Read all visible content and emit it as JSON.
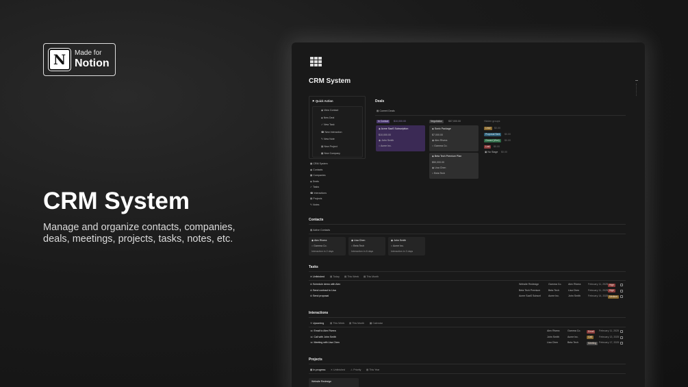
{
  "badge": {
    "made_for": "Made for",
    "notion": "Notion",
    "logo_letter": "N"
  },
  "hero": {
    "title": "CRM System",
    "subtitle": "Manage and organize contacts, companies, deals, meetings, projects, tasks, notes, etc."
  },
  "page": {
    "title": "CRM System",
    "icon": "grid-icon"
  },
  "quick_action": {
    "title": "Quick Action",
    "items": [
      "View Contact",
      "New Deal",
      "New Task",
      "New Interaction",
      "New Note",
      "New Project",
      "New Company"
    ]
  },
  "nav": {
    "items": [
      "CRM System",
      "Contacts",
      "Companies",
      "Deals",
      "Tasks",
      "Interactions",
      "Projects",
      "Notes"
    ]
  },
  "deals": {
    "title": "Deals",
    "view": "Current Deals",
    "col1": {
      "status": "In Contact",
      "amount": "$10,000.00",
      "card": {
        "title": "Acme SaaS Subscription",
        "amount": "$10,000.00",
        "contact": "John Smith",
        "company": "Acme Inc."
      }
    },
    "col2": {
      "status": "Negotiation",
      "amount": "$57,000.00",
      "cards": [
        {
          "title": "Sonic Package",
          "amount": "$7,000.00",
          "contact": "Alex Rivera",
          "company": "Gamma Co."
        },
        {
          "title": "Beta Tech Premium Plan",
          "amount": "$50,000.00",
          "contact": "Lisa Chen",
          "company": "Beta Tech"
        }
      ]
    },
    "hidden": {
      "title": "Hidden groups",
      "groups": [
        {
          "label": "Lead",
          "amount": "$0.00",
          "color": "#c7893f"
        },
        {
          "label": "Proposal Sent",
          "amount": "$0.00",
          "color": "#2e6f8f"
        },
        {
          "label": "Closed (Won)",
          "amount": "$0.00",
          "color": "#2f7a4f"
        },
        {
          "label": "Lost",
          "amount": "$0.00",
          "color": "#a23b3b"
        }
      ],
      "no_stage": "No Stage",
      "no_stage_amount": "$0.00"
    }
  },
  "contacts": {
    "title": "Contacts",
    "view": "Active Contacts",
    "cards": [
      {
        "name": "Alex Rivera",
        "company": "Gamma Co.",
        "note": "Interaction in 2 days"
      },
      {
        "name": "Lisa Chen",
        "company": "Beta Tech",
        "note": "Interaction in 8 days"
      },
      {
        "name": "John Smith",
        "company": "Acme Inc.",
        "note": "Interaction in 3 days"
      }
    ]
  },
  "tasks": {
    "title": "Tasks",
    "tabs": [
      "Unfinished",
      "Today",
      "This Week",
      "This Month"
    ],
    "rows": [
      {
        "title": "Schedule demo with Alex",
        "project": "Website Redesign",
        "company": "Gamma Co.",
        "contact": "Alex Rivera",
        "date": "February 11, 2025",
        "priority": "High",
        "pcolor": "#8a3a3a"
      },
      {
        "title": "Send contract to Lisa",
        "project": "Beta Tech Premium",
        "company": "Beta Tech",
        "contact": "Lisa Chen",
        "date": "February 11, 2025",
        "priority": "High",
        "pcolor": "#8a3a3a"
      },
      {
        "title": "Send proposal",
        "project": "Acme SaaS Subscri",
        "company": "Acme Inc.",
        "contact": "John Smith",
        "date": "February 14, 2025",
        "priority": "Medium",
        "pcolor": "#8a6a2f"
      }
    ]
  },
  "interactions": {
    "title": "Interactions",
    "tabs": [
      "Upcoming",
      "This Week",
      "This Month",
      "Calendar"
    ],
    "rows": [
      {
        "title": "Email to Alex Rivera",
        "contact": "Alex Rivera",
        "company": "Gamma Co.",
        "type": "Email",
        "tcolor": "#8a3a3a",
        "date": "February 11, 2025"
      },
      {
        "title": "Call with John Smith",
        "contact": "John Smith",
        "company": "Acme Inc.",
        "type": "Call",
        "tcolor": "#8a6a2f",
        "date": "February 13, 2025"
      },
      {
        "title": "Meeting with Lisa Chen",
        "contact": "Lisa Chen",
        "company": "Beta Tech",
        "type": "Meeting",
        "tcolor": "#4a4a4a",
        "date": "February 17, 2025"
      }
    ]
  },
  "projects": {
    "title": "Projects",
    "tabs": [
      "In progress",
      "Unfinished",
      "Priority",
      "This Year"
    ],
    "card": "Website Redesign"
  }
}
